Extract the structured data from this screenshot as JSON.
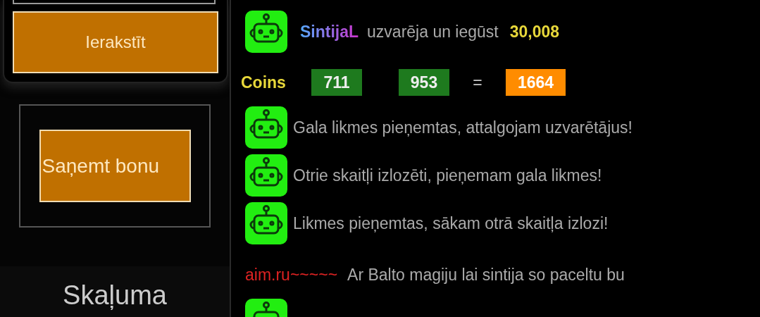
{
  "sidebar": {
    "save_button": "Ierakstīt",
    "bonus_button": "Saņemt bonu",
    "volume_label": "Skaļuma"
  },
  "chat": [
    {
      "kind": "tag"
    },
    {
      "kind": "win",
      "user": "SintijaL",
      "text": "uzvarēja un iegūst",
      "amount": "30,008"
    },
    {
      "kind": "coins",
      "label": "Coins",
      "first": "711",
      "second": "953",
      "equals": "=",
      "total": "1664"
    },
    {
      "kind": "bot",
      "text": "Gala likmes pieņemtas, attalgojam uzvarētājus!"
    },
    {
      "kind": "bot",
      "text": "Otrie skaitļi izlozēti, pieņemam gala likmes!"
    },
    {
      "kind": "bot",
      "text": "Likmes pieņemtas, sākam otrā skaitļa izlozi!"
    },
    {
      "kind": "user",
      "user": "aim.ru~~~~~",
      "text": "Ar Balto magiju lai sintija so paceltu bu"
    },
    {
      "kind": "avatar"
    }
  ]
}
